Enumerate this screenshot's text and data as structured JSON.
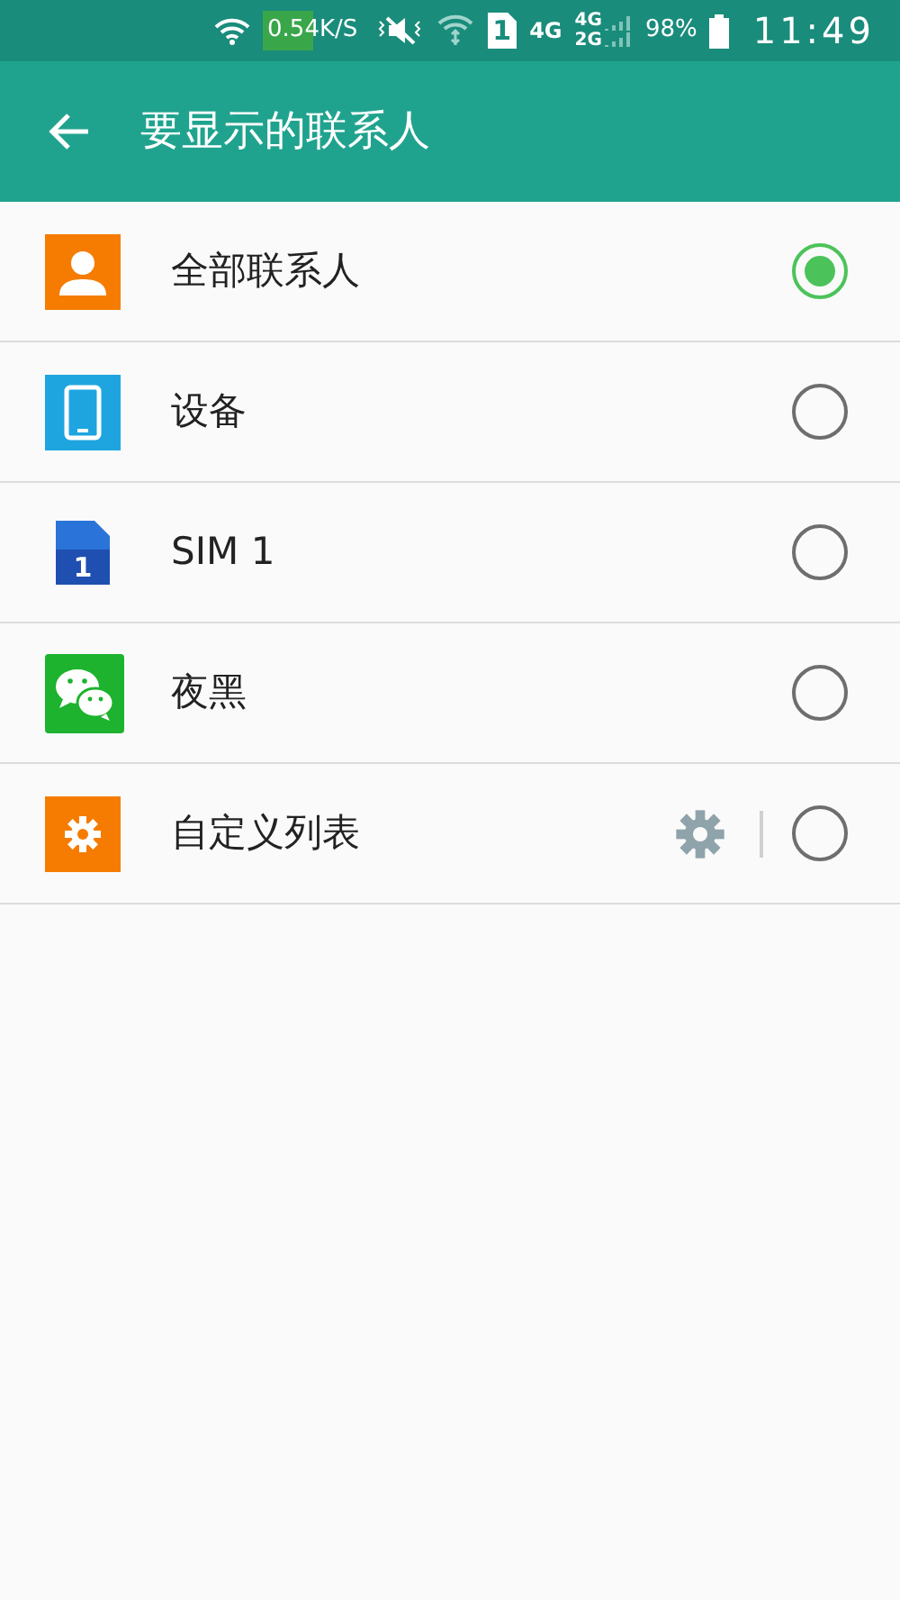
{
  "status_bar": {
    "speed": "0.54K/S",
    "sim_slot": "1",
    "network": "4G",
    "network_top": "4G",
    "network_bottom": "2G",
    "battery": "98%",
    "time": "11:49"
  },
  "app_bar": {
    "title": "要显示的联系人"
  },
  "items": [
    {
      "label": "全部联系人",
      "kind": "person",
      "selected": true
    },
    {
      "label": "设备",
      "kind": "tablet",
      "selected": false
    },
    {
      "label": "SIM 1",
      "kind": "sim",
      "badge": "1",
      "selected": false
    },
    {
      "label": "夜黑",
      "kind": "chat",
      "selected": false
    },
    {
      "label": "自定义列表",
      "kind": "gear",
      "selected": false,
      "settings": true
    }
  ]
}
